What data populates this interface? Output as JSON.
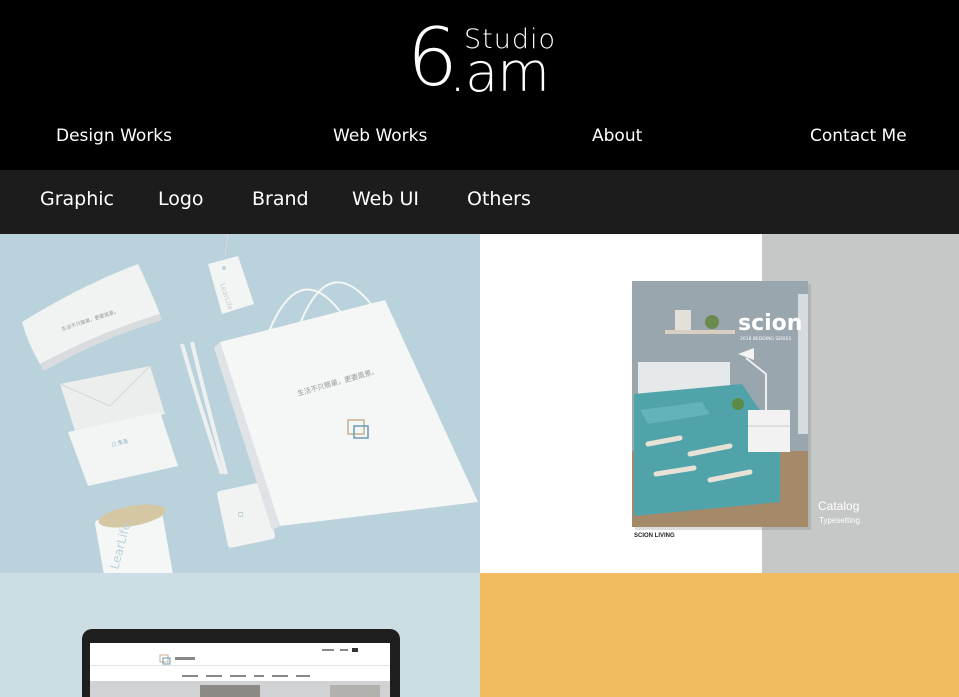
{
  "logo": {
    "digit": "6",
    "studio": "Studio",
    "am": ".am"
  },
  "main_nav": {
    "design_works": "Design Works",
    "web_works": "Web Works",
    "about": "About",
    "contact_me": "Contact Me"
  },
  "sub_nav": {
    "graphic": "Graphic",
    "logo": "Logo",
    "brand": "Brand",
    "web_ui": "Web UI",
    "others": "Others"
  },
  "portfolio": {
    "catalog": {
      "cover_brand": "scion",
      "cover_series": "2018 BEDDING SERIES",
      "caption_title": "Catalog",
      "caption_sub": "Typesetting",
      "footer_brand": "SCION LIVING"
    },
    "brand": {
      "bag_slogan": "生活不只簡單，更要風景。",
      "box_slogan": "生活不只簡單，更要風景。",
      "tag_text": "LearLife",
      "jar_text": "LearLife"
    }
  },
  "colors": {
    "header_bg": "#000000",
    "subnav_bg": "#1c1c1c",
    "brand_tile_bg": "#b9d2db",
    "web_tile_bg": "#ccdde4",
    "orange_tile_bg": "#f2bb5f",
    "catalog_grey": "#c6c7c7"
  }
}
